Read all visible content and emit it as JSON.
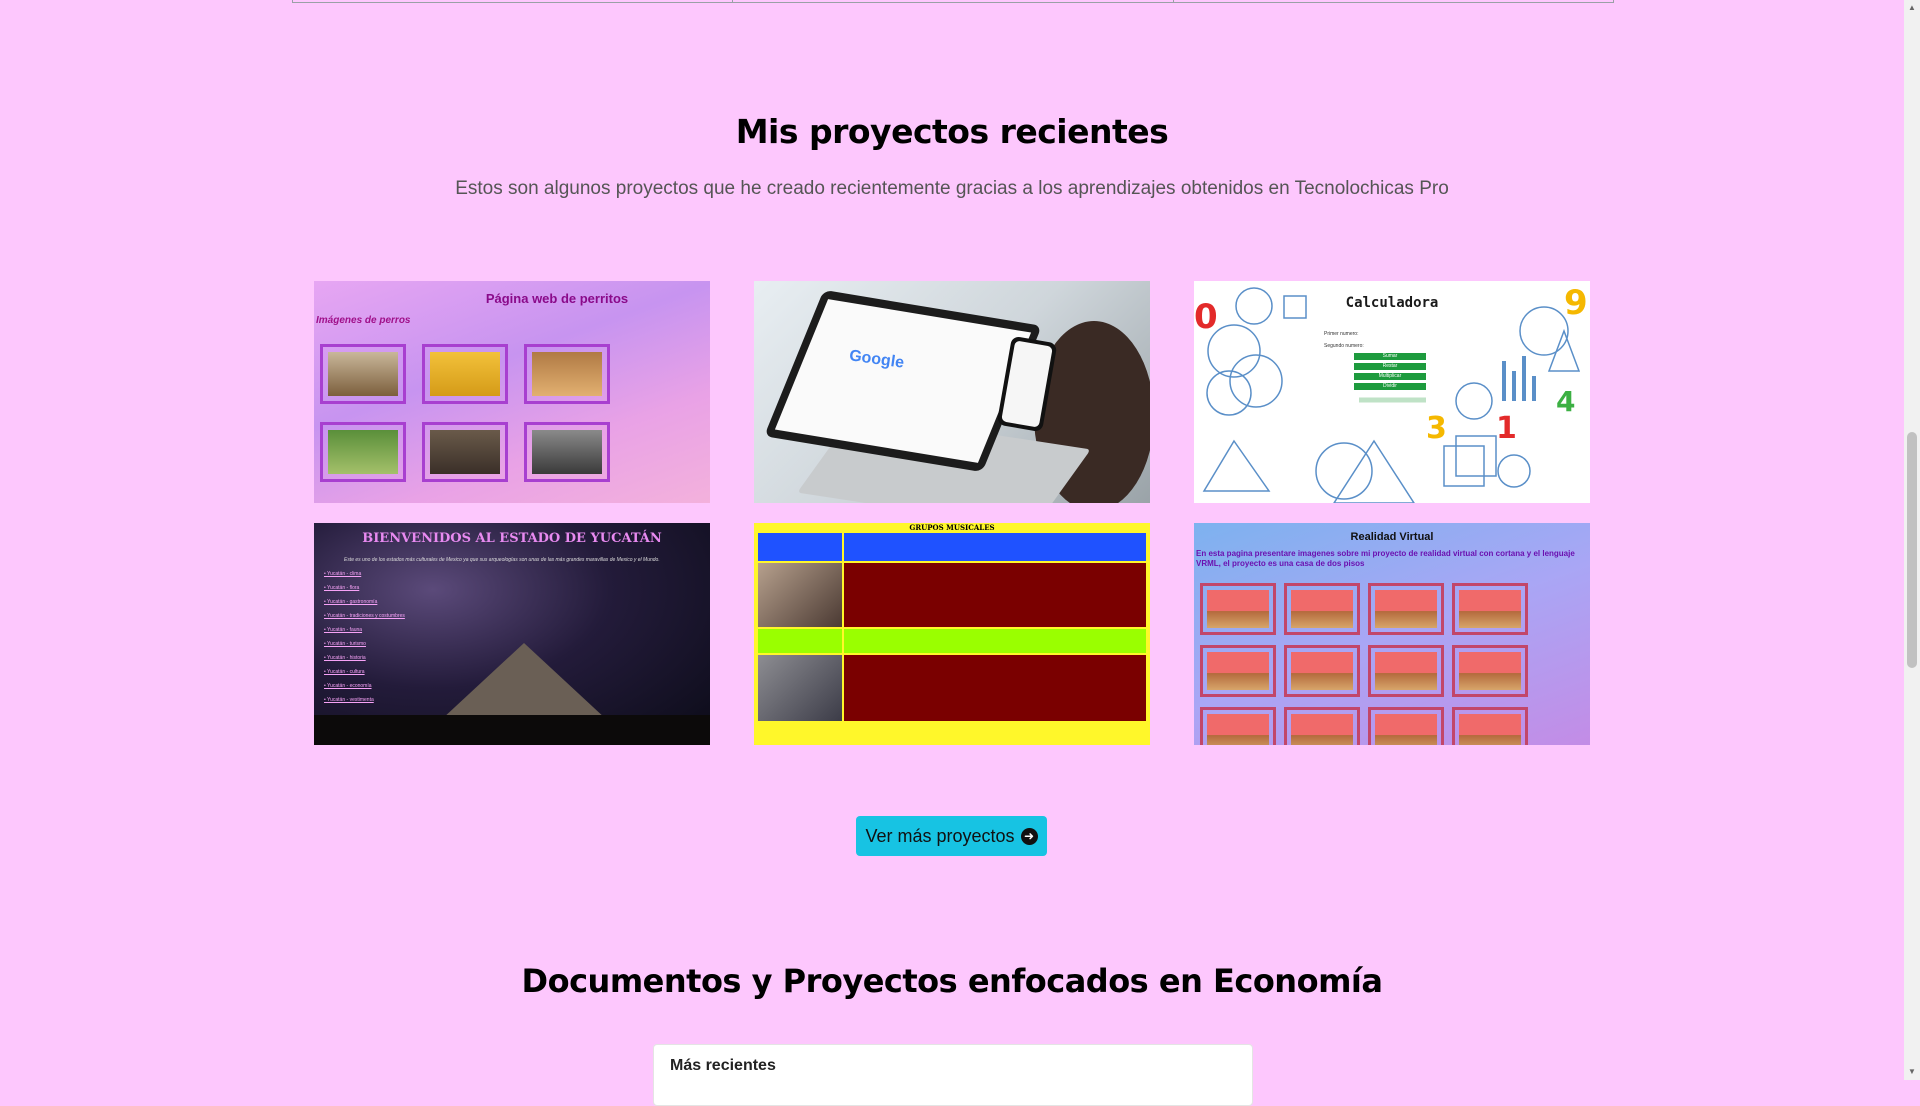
{
  "projects": {
    "title": "Mis proyectos recientes",
    "subtitle": "Estos son algunos proyectos que he creado recientemente gracias a los aprendizajes obtenidos en Tecnolochicas Pro",
    "cards": [
      {
        "name": "perritos",
        "title": "Página web de perritos",
        "subtitle": "Imágenes de perros"
      },
      {
        "name": "laptop-google",
        "logo": "Google"
      },
      {
        "name": "calculadora",
        "title": "Calculadora",
        "labels": [
          "Primer numero:",
          "Segundo numero:"
        ],
        "buttons": [
          "Sumar",
          "Restar",
          "Multiplicar",
          "Dividir"
        ]
      },
      {
        "name": "yucatan",
        "title": "BIENVENIDOS AL ESTADO DE YUCATÁN",
        "description": "Este es uno de los estados más culturales de Mexico ya que sus arqueologías son unas de las más grandes maravillas de Mexico y el Mundo."
      },
      {
        "name": "grupos-musicales",
        "title": "GRUPOS MUSICALES"
      },
      {
        "name": "realidad-virtual",
        "title": "Realidad Virtual",
        "description": "En esta pagina presentare imagenes sobre mi proyecto de realidad virtual con cortana y el lenguaje VRML, el proyecto es una casa de dos pisos"
      }
    ],
    "more_button": "Ver más proyectos"
  },
  "docs": {
    "title": "Documentos y Proyectos enfocados en Economía",
    "tab_header": "Más recientes"
  },
  "colors": {
    "background": "#fdc7fd",
    "accent_button": "#17c3e3"
  }
}
